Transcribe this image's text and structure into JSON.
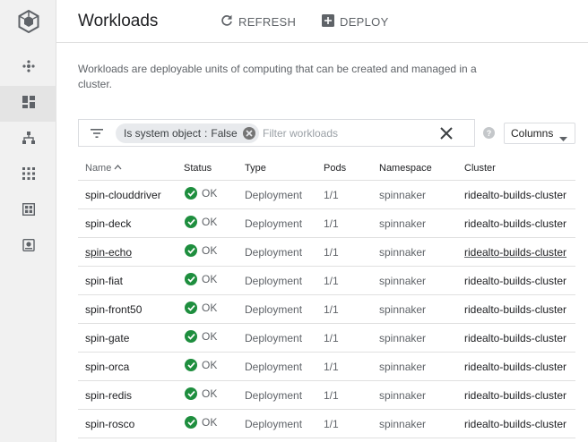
{
  "header": {
    "title": "Workloads",
    "refresh_label": "REFRESH",
    "deploy_label": "DEPLOY"
  },
  "description": "Workloads are deployable units of computing that can be created and managed in a cluster.",
  "filter": {
    "chip_key": "Is system object",
    "chip_sep": ":",
    "chip_value": "False",
    "placeholder": "Filter workloads",
    "value": ""
  },
  "columns_label": "Columns",
  "table": {
    "headers": {
      "name": "Name",
      "status": "Status",
      "type": "Type",
      "pods": "Pods",
      "namespace": "Namespace",
      "cluster": "Cluster"
    },
    "rows": [
      {
        "name": "spin-clouddriver",
        "status": "OK",
        "type": "Deployment",
        "pods": "1/1",
        "namespace": "spinnaker",
        "cluster": "ridealto-builds-cluster"
      },
      {
        "name": "spin-deck",
        "status": "OK",
        "type": "Deployment",
        "pods": "1/1",
        "namespace": "spinnaker",
        "cluster": "ridealto-builds-cluster"
      },
      {
        "name": "spin-echo",
        "status": "OK",
        "type": "Deployment",
        "pods": "1/1",
        "namespace": "spinnaker",
        "cluster": "ridealto-builds-cluster"
      },
      {
        "name": "spin-fiat",
        "status": "OK",
        "type": "Deployment",
        "pods": "1/1",
        "namespace": "spinnaker",
        "cluster": "ridealto-builds-cluster"
      },
      {
        "name": "spin-front50",
        "status": "OK",
        "type": "Deployment",
        "pods": "1/1",
        "namespace": "spinnaker",
        "cluster": "ridealto-builds-cluster"
      },
      {
        "name": "spin-gate",
        "status": "OK",
        "type": "Deployment",
        "pods": "1/1",
        "namespace": "spinnaker",
        "cluster": "ridealto-builds-cluster"
      },
      {
        "name": "spin-orca",
        "status": "OK",
        "type": "Deployment",
        "pods": "1/1",
        "namespace": "spinnaker",
        "cluster": "ridealto-builds-cluster"
      },
      {
        "name": "spin-redis",
        "status": "OK",
        "type": "Deployment",
        "pods": "1/1",
        "namespace": "spinnaker",
        "cluster": "ridealto-builds-cluster"
      },
      {
        "name": "spin-rosco",
        "status": "OK",
        "type": "Deployment",
        "pods": "1/1",
        "namespace": "spinnaker",
        "cluster": "ridealto-builds-cluster"
      }
    ]
  },
  "rail": {
    "items": [
      {
        "icon": "clusters-icon",
        "active": false
      },
      {
        "icon": "workloads-icon",
        "active": true
      },
      {
        "icon": "services-icon",
        "active": false
      },
      {
        "icon": "applications-icon",
        "active": false
      },
      {
        "icon": "configuration-icon",
        "active": false
      },
      {
        "icon": "storage-icon",
        "active": false
      }
    ]
  },
  "colors": {
    "status_ok": "#1e8e3e",
    "rail_bg": "#f1f1f1",
    "icon_grey": "#5f6368"
  }
}
